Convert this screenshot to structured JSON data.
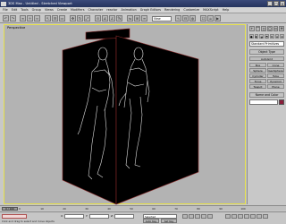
{
  "window": {
    "title": "3DS Max - Untitled - Stretched Viewport",
    "controls": [
      "_",
      "□",
      "×"
    ]
  },
  "menubar": {
    "items": [
      "File",
      "Edit",
      "Tools",
      "Group",
      "Views",
      "Create",
      "Modifiers",
      "Character",
      "reactor",
      "Animation",
      "Graph Editors",
      "Rendering",
      "Customize",
      "MAXScript",
      "Help"
    ]
  },
  "toolbar": {
    "view_select": "View"
  },
  "viewport": {
    "label": "Perspective",
    "border_color": "#e6e047",
    "panel_color": "#000000",
    "panel_edge_color": "#8a2a2a"
  },
  "command_panel": {
    "tab_icons": [
      "+",
      "⌒",
      "◻",
      "◯",
      "▭",
      "⚒"
    ],
    "toolbar_icons": [
      "●",
      "◐",
      "◒",
      "◓",
      "⚙",
      "≡",
      "⊕"
    ],
    "category": "Standard Primitives",
    "section_object_type": "Object Type",
    "autogrid": "AutoGrid",
    "objects": [
      "Box",
      "Cone",
      "Sphere",
      "GeoSphere",
      "Cylinder",
      "Tube",
      "Torus",
      "Pyramid",
      "Teapot",
      "Plane"
    ],
    "section_name": "Name and Color",
    "swatch_color": "#8a1d3a"
  },
  "timeline": {
    "slider": "0 / 100",
    "ticks": [
      "0",
      "10",
      "20",
      "30",
      "40",
      "50",
      "60",
      "70",
      "80",
      "90",
      "100"
    ]
  },
  "statusbar": {
    "prompt": "Click and drag to select and move objects",
    "x_label": "X:",
    "y_label": "Y:",
    "z_label": "Z:",
    "auto_key": "Auto Key",
    "set_key": "Set Key",
    "selected": "Selected"
  }
}
